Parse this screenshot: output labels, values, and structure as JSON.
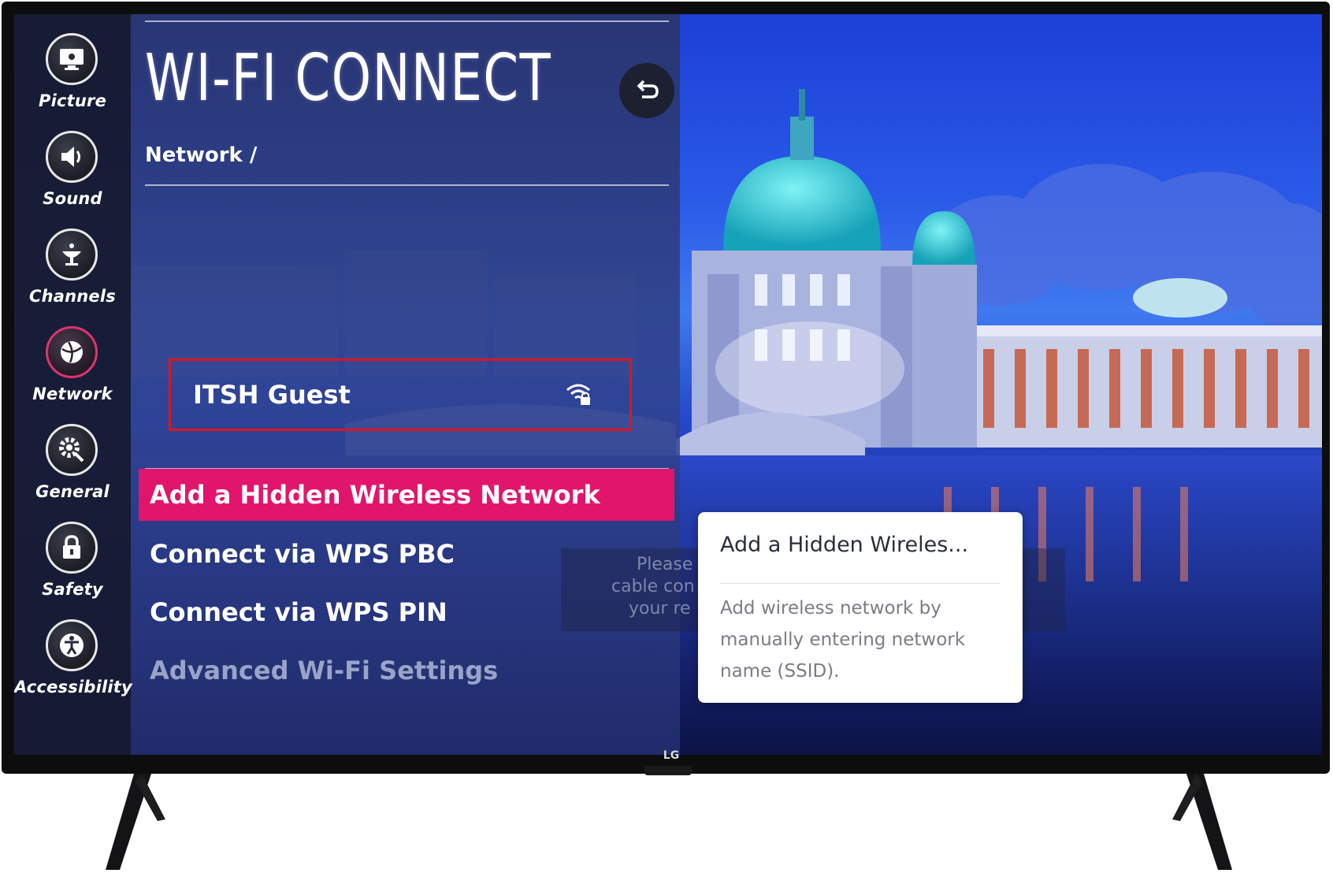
{
  "screen": {
    "title": "WI-FI CONNECT",
    "breadcrumb": "Network /"
  },
  "sidebar": {
    "items": [
      {
        "label": "Picture",
        "icon": "picture-icon"
      },
      {
        "label": "Sound",
        "icon": "speaker-icon"
      },
      {
        "label": "Channels",
        "icon": "antenna-icon"
      },
      {
        "label": "Network",
        "icon": "globe-icon",
        "active": true
      },
      {
        "label": "General",
        "icon": "gear-icon"
      },
      {
        "label": "Safety",
        "icon": "lock-icon"
      },
      {
        "label": "Accessibility",
        "icon": "accessibility-icon"
      }
    ]
  },
  "networks": [
    {
      "name": "ITSH Guest",
      "secured": true,
      "highlighted": true
    }
  ],
  "menu": {
    "items": [
      {
        "label": "Add a Hidden Wireless Network",
        "selected": true
      },
      {
        "label": "Connect via WPS PBC"
      },
      {
        "label": "Connect via WPS PIN"
      },
      {
        "label": "Advanced Wi-Fi Settings",
        "dimmed": true
      }
    ]
  },
  "background_text": {
    "line1": "Please c",
    "line2": "cable con",
    "line3": "your re"
  },
  "tooltip": {
    "title": "Add a Hidden Wireles...",
    "body": "Add wireless network by manually entering network name (SSID)."
  },
  "brand": {
    "logo": "LG"
  },
  "colors": {
    "accent": "#e2156c",
    "highlight_border": "#e0141c",
    "active_ring": "#e0336e"
  }
}
